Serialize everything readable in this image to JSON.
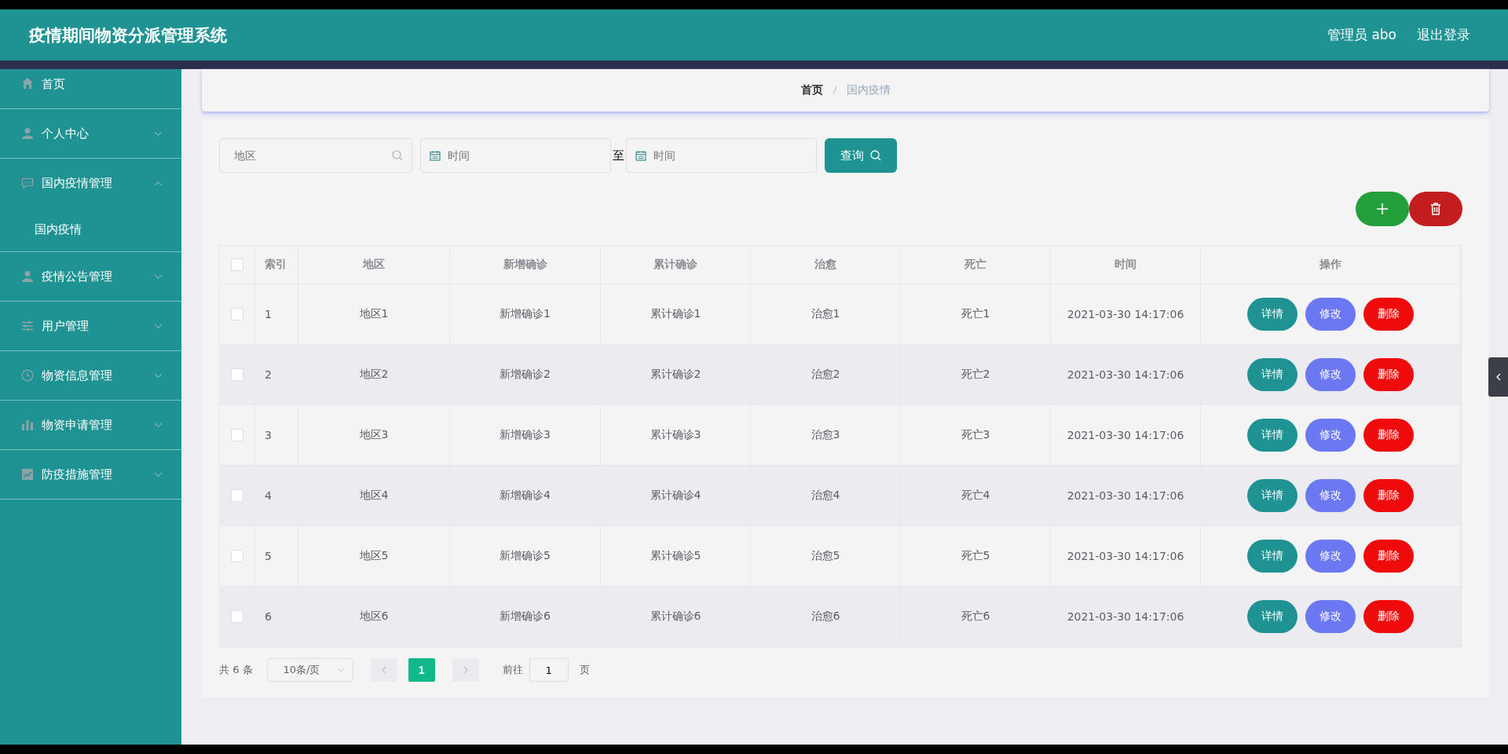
{
  "header": {
    "title": "疫情期间物资分派管理系统",
    "user": "管理员 abo",
    "logout": "退出登录"
  },
  "sidebar": {
    "items": [
      {
        "label": "首页",
        "kind": "link",
        "selected": false
      },
      {
        "label": "个人中心",
        "kind": "menu",
        "expanded": false,
        "selected": false
      },
      {
        "label": "国内疫情管理",
        "kind": "menu",
        "expanded": true,
        "selected": false,
        "children": [
          {
            "label": "国内疫情",
            "selected": true
          }
        ]
      },
      {
        "label": "疫情公告管理",
        "kind": "menu",
        "expanded": false,
        "selected": false
      },
      {
        "label": "用户管理",
        "kind": "menu",
        "expanded": false,
        "selected": false
      },
      {
        "label": "物资信息管理",
        "kind": "menu",
        "expanded": false,
        "selected": false
      },
      {
        "label": "物资申请管理",
        "kind": "menu",
        "expanded": false,
        "selected": false
      },
      {
        "label": "防疫措施管理",
        "kind": "menu",
        "expanded": false,
        "selected": false
      }
    ]
  },
  "breadcrumb": [
    "首页",
    "国内疫情"
  ],
  "search": {
    "region_placeholder": "地区",
    "start_placeholder": "时间",
    "separator": "至",
    "end_placeholder": "时间",
    "button": "查询"
  },
  "table": {
    "columns": [
      "索引",
      "地区",
      "新增确诊",
      "累计确诊",
      "治愈",
      "死亡",
      "时间",
      "操作"
    ],
    "header_checked": false,
    "rows": [
      {
        "checked": false,
        "cells": [
          "1",
          "地区1",
          "新增确诊1",
          "累计确诊1",
          "治愈1",
          "死亡1",
          "2021-03-30 14:17:06"
        ],
        "actions": [
          "详情",
          "修改",
          "删除"
        ]
      },
      {
        "checked": false,
        "cells": [
          "2",
          "地区2",
          "新增确诊2",
          "累计确诊2",
          "治愈2",
          "死亡2",
          "2021-03-30 14:17:06"
        ],
        "actions": [
          "详情",
          "修改",
          "删除"
        ]
      },
      {
        "checked": false,
        "cells": [
          "3",
          "地区3",
          "新增确诊3",
          "累计确诊3",
          "治愈3",
          "死亡3",
          "2021-03-30 14:17:06"
        ],
        "actions": [
          "详情",
          "修改",
          "删除"
        ]
      },
      {
        "checked": false,
        "cells": [
          "4",
          "地区4",
          "新增确诊4",
          "累计确诊4",
          "治愈4",
          "死亡4",
          "2021-03-30 14:17:06"
        ],
        "actions": [
          "详情",
          "修改",
          "删除"
        ]
      },
      {
        "checked": false,
        "cells": [
          "5",
          "地区5",
          "新增确诊5",
          "累计确诊5",
          "治愈5",
          "死亡5",
          "2021-03-30 14:17:06"
        ],
        "actions": [
          "详情",
          "修改",
          "删除"
        ]
      },
      {
        "checked": false,
        "cells": [
          "6",
          "地区6",
          "新增确诊6",
          "累计确诊6",
          "治愈6",
          "死亡6",
          "2021-03-30 14:17:06"
        ],
        "actions": [
          "详情",
          "修改",
          "删除"
        ]
      }
    ]
  },
  "pagination": {
    "total": "共 6 条",
    "page_size": "10条/页",
    "pages": [
      {
        "label": "1",
        "selected": true
      }
    ],
    "goto_label": "前往",
    "goto_value": "1",
    "goto_suffix": "页"
  }
}
